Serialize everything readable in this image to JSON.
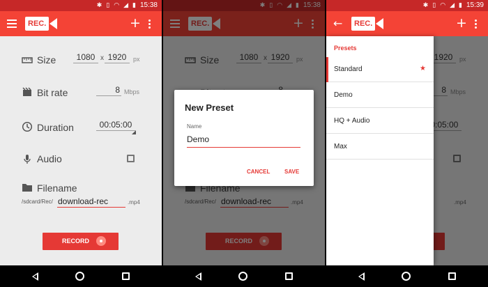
{
  "colors": {
    "primary": "#f44336",
    "primary_dark": "#c62828",
    "accent": "#e53935",
    "background": "#ececec"
  },
  "logo_text": "REC.",
  "icons": {
    "menu": "hamburger-icon",
    "back": "arrow-back-icon",
    "add": "plus-icon",
    "more": "more-vert-icon",
    "size": "ruler-icon",
    "bitrate": "film-icon",
    "duration": "clock-icon",
    "audio": "microphone-icon",
    "filename": "folder-icon",
    "star": "star-icon"
  },
  "screens": [
    {
      "status_time": "15:38"
    },
    {
      "status_time": "15:38"
    },
    {
      "status_time": "15:39"
    }
  ],
  "settings": {
    "size_label": "Size",
    "width": "1080",
    "height": "1920",
    "size_separator": "x",
    "size_unit": "px",
    "bitrate_label": "Bit rate",
    "bitrate_value": "8",
    "bitrate_unit": "Mbps",
    "duration_label": "Duration",
    "duration_value": "00:05:00",
    "audio_label": "Audio",
    "audio_checked": false,
    "filename_label": "Filename",
    "filename_path": "/sdcard/Rec/",
    "filename_value": "download-rec",
    "filename_ext": ".mp4",
    "record_label": "RECORD"
  },
  "dialog": {
    "title": "New Preset",
    "field_label": "Name",
    "field_value": "Demo",
    "cancel_label": "CANCEL",
    "save_label": "SAVE"
  },
  "drawer": {
    "header": "Presets",
    "items": [
      {
        "label": "Standard",
        "default": true
      },
      {
        "label": "Demo"
      },
      {
        "label": "HQ + Audio"
      },
      {
        "label": "Max"
      }
    ]
  }
}
